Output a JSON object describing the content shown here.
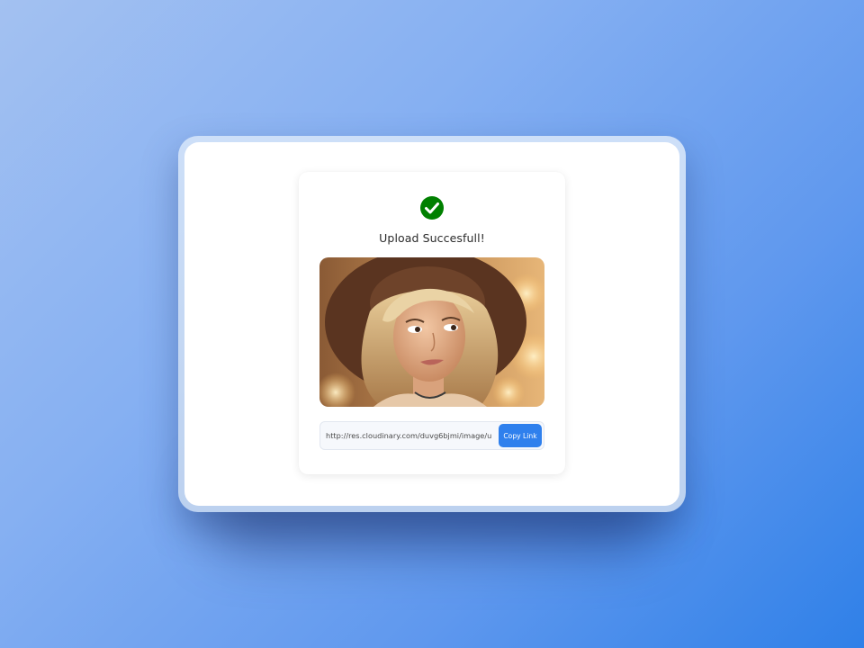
{
  "upload": {
    "title": "Upload Succesfull!",
    "status_icon": "check-circle-icon",
    "success_color": "#008000",
    "image_alt": "Uploaded portrait image"
  },
  "link": {
    "url": "http://res.cloudinary.com/duvg6bjmi/image/u",
    "copy_label": "Copy Link"
  },
  "colors": {
    "accent": "#2f80ed"
  }
}
